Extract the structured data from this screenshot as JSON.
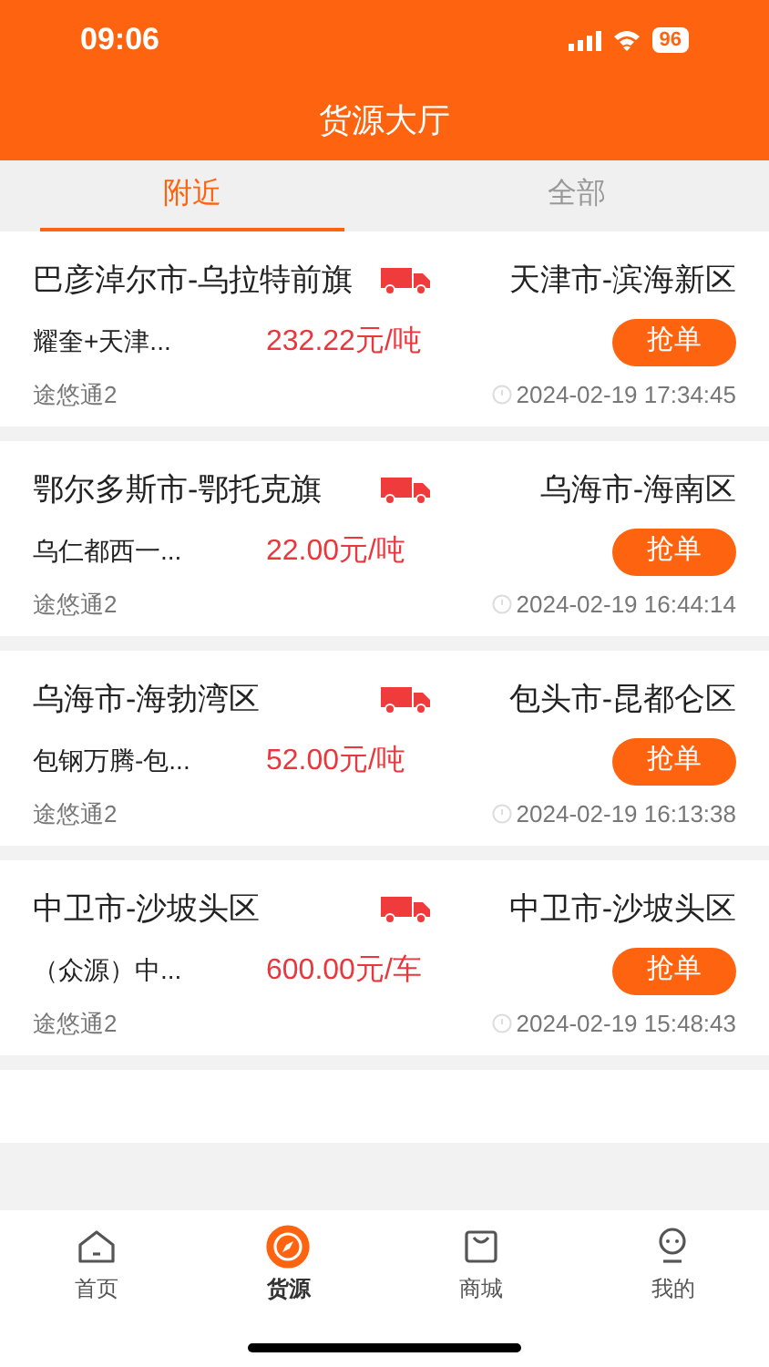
{
  "status_bar": {
    "time": "09:06",
    "battery": "96"
  },
  "header": {
    "title": "货源大厅"
  },
  "tabs": [
    {
      "label": "附近",
      "selected": true
    },
    {
      "label": "全部",
      "selected": false
    }
  ],
  "orders": [
    {
      "origin": "巴彦淖尔市-乌拉特前旗",
      "destination": "天津市-滨海新区",
      "cargo": "耀奎+天津...",
      "price": "232.22元/吨",
      "action": "抢单",
      "company": "途悠通2",
      "time": "2024-02-19 17:34:45"
    },
    {
      "origin": "鄂尔多斯市-鄂托克旗",
      "destination": "乌海市-海南区",
      "cargo": "乌仁都西一...",
      "price": "22.00元/吨",
      "action": "抢单",
      "company": "途悠通2",
      "time": "2024-02-19 16:44:14"
    },
    {
      "origin": "乌海市-海勃湾区",
      "destination": "包头市-昆都仑区",
      "cargo": "包钢万腾-包...",
      "price": "52.00元/吨",
      "action": "抢单",
      "company": "途悠通2",
      "time": "2024-02-19 16:13:38"
    },
    {
      "origin": "中卫市-沙坡头区",
      "destination": "中卫市-沙坡头区",
      "cargo": "（众源）中...",
      "price": "600.00元/车",
      "action": "抢单",
      "company": "途悠通2",
      "time": "2024-02-19 15:48:43"
    }
  ],
  "nav": [
    {
      "label": "首页",
      "kind": "home",
      "selected": false
    },
    {
      "label": "货源",
      "kind": "compass",
      "selected": true
    },
    {
      "label": "商城",
      "kind": "bag",
      "selected": false
    },
    {
      "label": "我的",
      "kind": "robot",
      "selected": false
    }
  ]
}
